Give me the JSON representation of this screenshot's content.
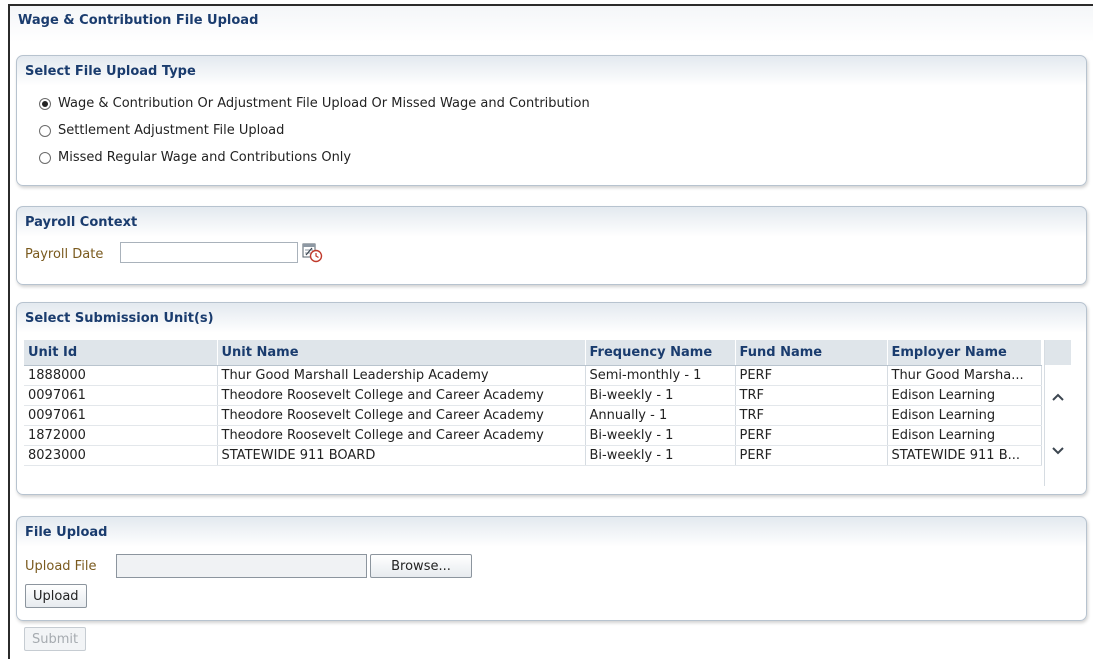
{
  "page": {
    "title": "Wage & Contribution File Upload"
  },
  "upload_type": {
    "title": "Select File Upload Type",
    "options": [
      {
        "label": "Wage & Contribution Or Adjustment File Upload Or Missed Wage and Contribution",
        "selected": true
      },
      {
        "label": "Settlement Adjustment File Upload",
        "selected": false
      },
      {
        "label": "Missed Regular Wage and Contributions Only",
        "selected": false
      }
    ]
  },
  "payroll": {
    "title": "Payroll Context",
    "date_label": "Payroll Date",
    "date_value": ""
  },
  "units": {
    "title": "Select Submission Unit(s)",
    "columns": [
      "Unit Id",
      "Unit Name",
      "Frequency Name",
      "Fund Name",
      "Employer Name"
    ],
    "rows": [
      [
        "1888000",
        "Thur Good Marshall Leadership Academy",
        "Semi-monthly - 1",
        "PERF",
        "Thur Good Marsha..."
      ],
      [
        "0097061",
        "Theodore Roosevelt College and Career Academy",
        "Bi-weekly - 1",
        "TRF",
        "Edison Learning"
      ],
      [
        "0097061",
        "Theodore Roosevelt College and Career Academy",
        "Annually - 1",
        "TRF",
        "Edison Learning"
      ],
      [
        "1872000",
        "Theodore Roosevelt College and Career Academy",
        "Bi-weekly - 1",
        "PERF",
        "Edison Learning"
      ],
      [
        "8023000",
        "STATEWIDE 911 BOARD",
        "Bi-weekly - 1",
        "PERF",
        "STATEWIDE 911 B..."
      ]
    ]
  },
  "file_upload": {
    "title": "File Upload",
    "file_label": "Upload File",
    "file_value": "",
    "browse_label": "Browse...",
    "upload_label": "Upload"
  },
  "submit_label": "Submit",
  "colors": {
    "heading": "#1a3c6e",
    "label": "#7a5a1e",
    "panel_border": "#b7c3cf"
  }
}
